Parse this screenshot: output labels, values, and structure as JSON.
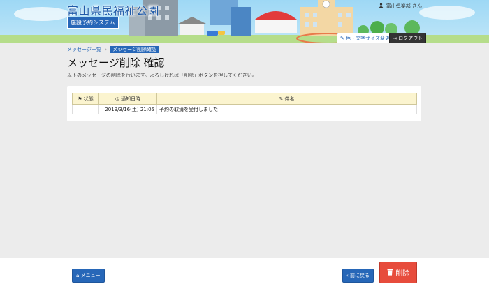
{
  "header": {
    "title": "富山県民福祉公園",
    "system_name": "施設予約システム",
    "user": "富山倶楽部 さん",
    "user_icon": "person-icon",
    "color_size_button": "色・文字サイズ変更",
    "logout_button": "ログアウト"
  },
  "breadcrumb": {
    "items": [
      "メッセージ一覧",
      "メッセージ削除確認"
    ]
  },
  "page": {
    "title": "メッセージ削除 確認",
    "instructions": "以下のメッセージの削除を行います。よろしければ「削除」ボタンを押してください。"
  },
  "table": {
    "headers": {
      "status": "状態",
      "notify_datetime": "通知日時",
      "subject": "件名"
    },
    "rows": [
      {
        "status": "",
        "notify_datetime": "2019/3/16(土) 21:05",
        "subject": "予約の取消を受付しました"
      }
    ]
  },
  "footer": {
    "menu_button": "メニュー",
    "back_button": "前に戻る",
    "delete_button": "削除"
  },
  "colors": {
    "primary": "#2767b8",
    "danger": "#e74c3c",
    "table_header": "#fbf4cf"
  }
}
